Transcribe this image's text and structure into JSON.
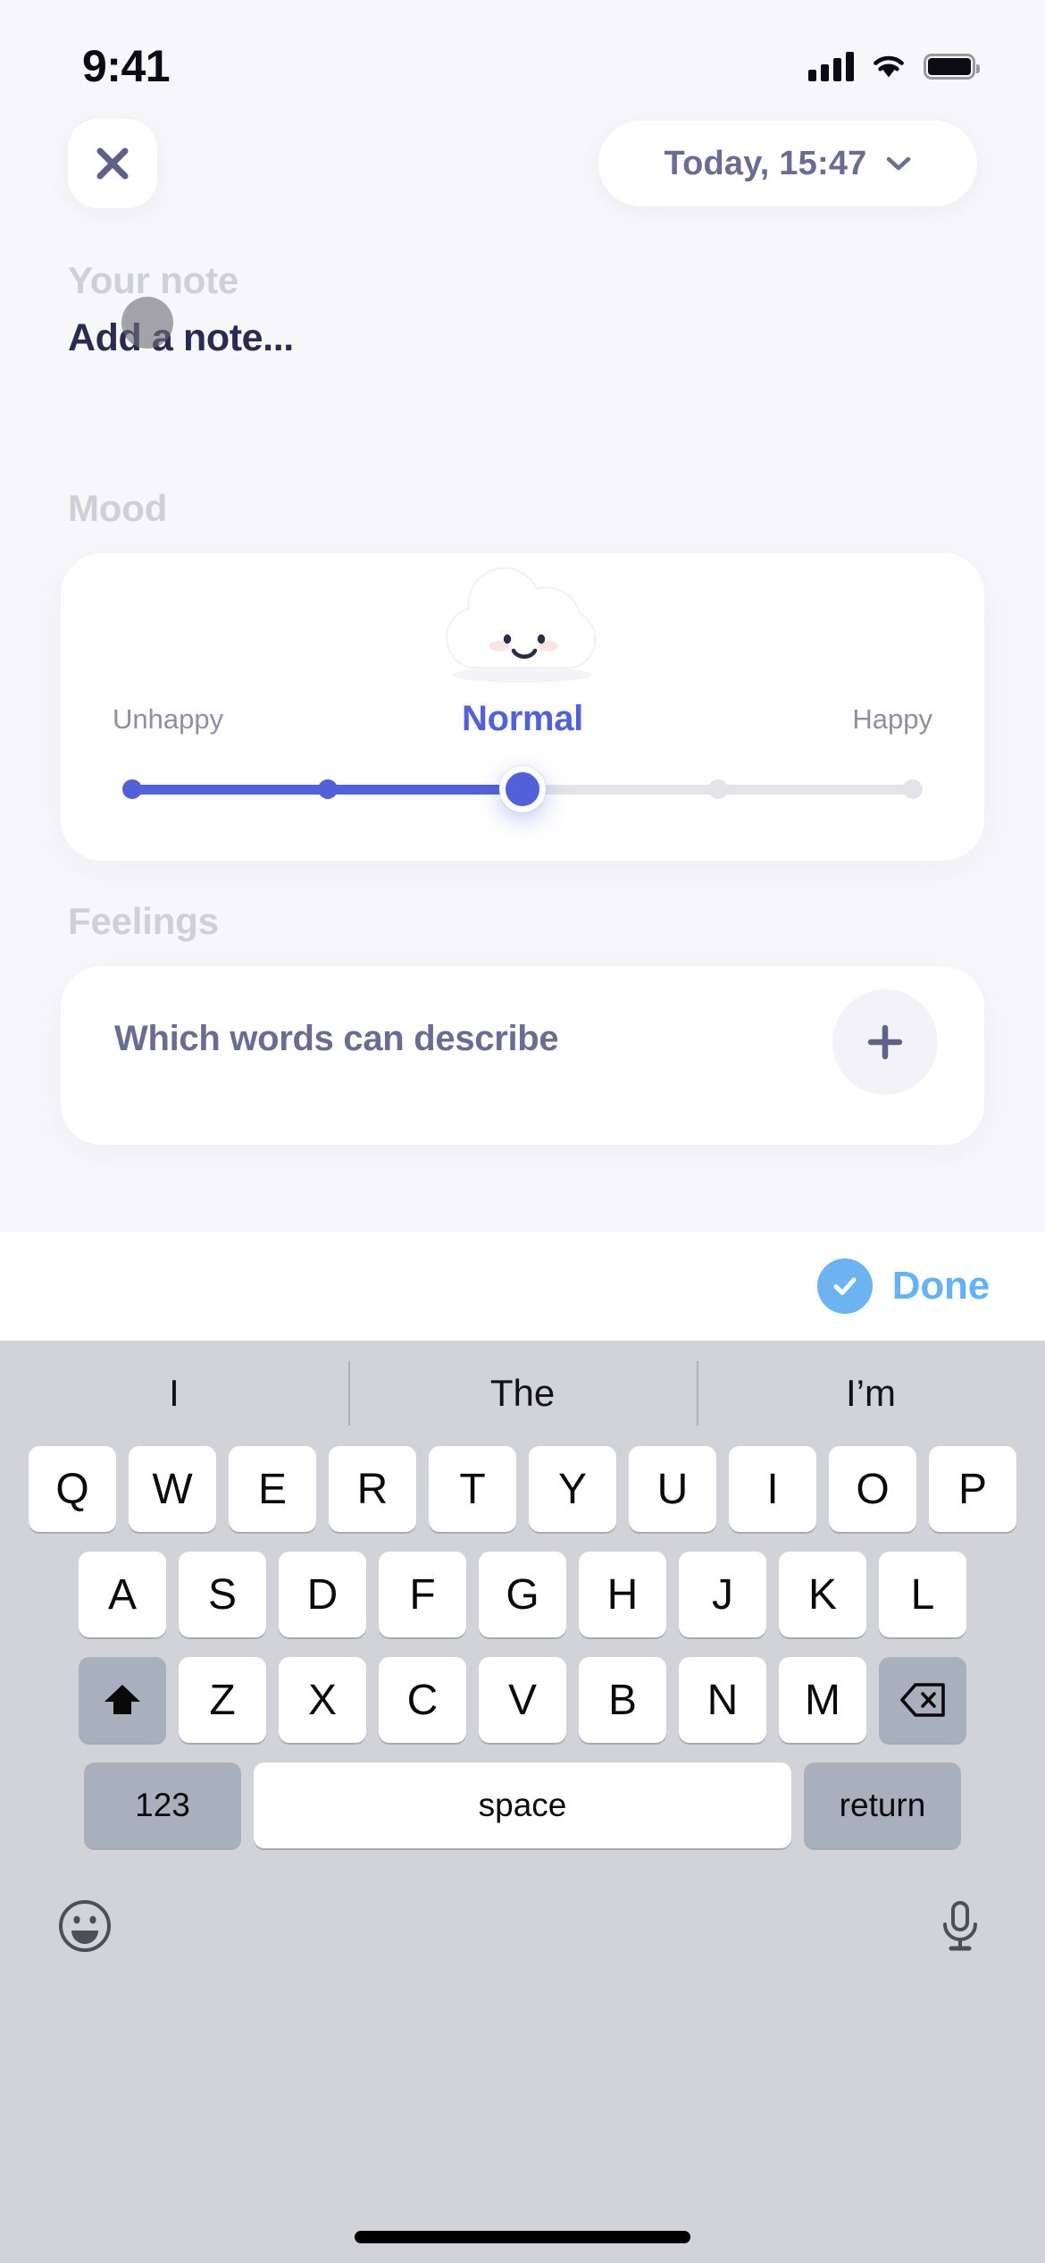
{
  "status_bar": {
    "time": "9:41",
    "signal_icon": "cellular-signal-icon",
    "wifi_icon": "wifi-icon",
    "battery_icon": "battery-icon"
  },
  "header": {
    "close_icon": "close-icon",
    "date_text": "Today, 15:47",
    "chevron_icon": "chevron-down-icon"
  },
  "note": {
    "section_label": "Your note",
    "value": "",
    "placeholder": "Add a note..."
  },
  "mood": {
    "section_label": "Mood",
    "illustration": "happy-cloud-icon",
    "left_label": "Unhappy",
    "right_label": "Happy",
    "current_label": "Normal",
    "value": 2,
    "min": 0,
    "max": 4,
    "steps": 5,
    "accent_color": "#5361d8",
    "track_color": "#e3e3e8"
  },
  "feelings": {
    "section_label": "Feelings",
    "question": "Which words can describe",
    "add_icon": "plus-icon"
  },
  "accessory_bar": {
    "done_icon": "check-circle-icon",
    "done_label": "Done",
    "done_color": "#66b2f5"
  },
  "keyboard": {
    "suggestions": [
      "I",
      "The",
      "I’m"
    ],
    "row1": [
      "Q",
      "W",
      "E",
      "R",
      "T",
      "Y",
      "U",
      "I",
      "O",
      "P"
    ],
    "row2": [
      "A",
      "S",
      "D",
      "F",
      "G",
      "H",
      "J",
      "K",
      "L"
    ],
    "row3": [
      "Z",
      "X",
      "C",
      "V",
      "B",
      "N",
      "M"
    ],
    "shift_icon": "shift-icon",
    "delete_icon": "backspace-icon",
    "numeric_label": "123",
    "space_label": "space",
    "return_label": "return",
    "emoji_icon": "emoji-icon",
    "dictation_icon": "microphone-icon"
  }
}
